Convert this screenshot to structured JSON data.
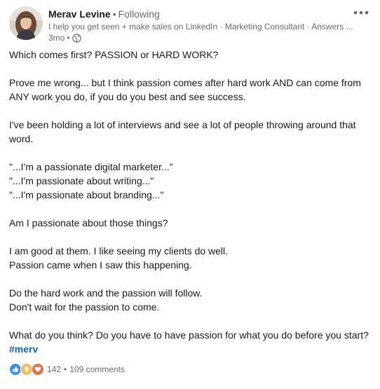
{
  "author": {
    "name": "Merav Levine",
    "separator": "•",
    "follow_status": "Following",
    "headline": "I help you get seen + make sales on LinkedIn · Marketing Consultant · Answers ...",
    "time_ago": "3mo",
    "time_separator": "•",
    "visibility_icon": "globe-icon"
  },
  "post": {
    "lines": [
      "Which comes first? PASSION or HARD WORK?",
      "",
      "Prove me wrong... but I think passion comes after hard work AND can come from",
      "ANY work you do, if you do you best and see success.",
      "",
      "I've been holding a lot of interviews and see a lot of people throwing around that",
      "word.",
      "",
      "\"...I'm a passionate digital marketer...\"",
      "\"...I'm passionate about writing...\"",
      "\"...I'm passionate about branding...\"",
      "",
      "Am I passionate about those things?",
      "",
      "I am good at them. I like seeing my clients do well.",
      "Passion came when I saw this happening.",
      "",
      "Do the hard work and the passion will follow.",
      "Don't wait for the passion to come.",
      "",
      "What do you think? Do you have to have passion for what you do before you start?"
    ],
    "hashtag": "#merv"
  },
  "social": {
    "reaction_icons": [
      "like-icon",
      "insightful-icon",
      "love-icon"
    ],
    "reaction_count": "142",
    "separator": "•",
    "comments": "109 comments"
  },
  "colors": {
    "link": "#0a66c2",
    "like": "#378fe9",
    "insightful": "#f5bb5c",
    "love": "#df704d"
  }
}
